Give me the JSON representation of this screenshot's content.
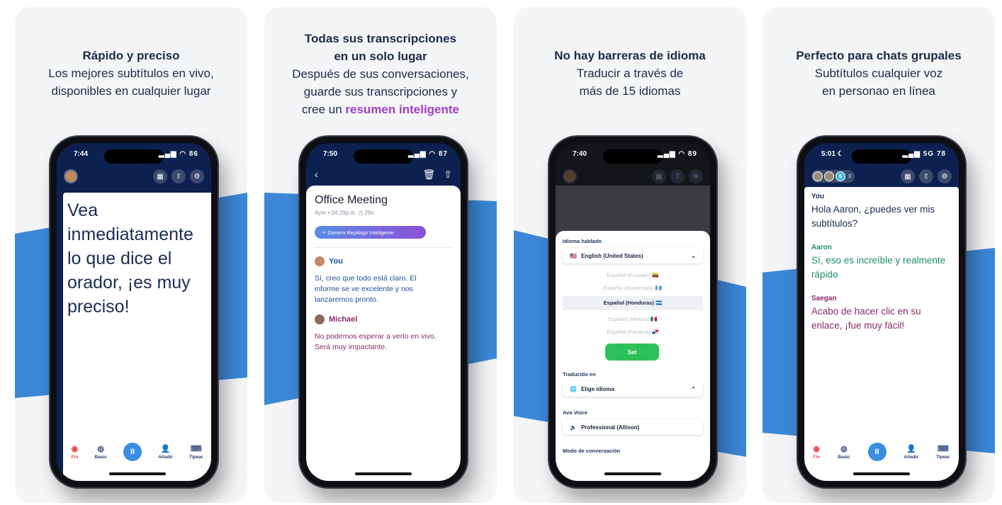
{
  "cards": [
    {
      "caption": {
        "heading": "Rápido y preciso",
        "line1": "Los mejores subtítulos en vivo,",
        "line2": "disponibles en cualquier lugar"
      },
      "status": {
        "time": "7:44",
        "battery": "86"
      },
      "transcript": "Vea inmediatamente lo que dice el orador, ¡es muy preciso!"
    },
    {
      "caption": {
        "heading1": "Todas sus transcripciones",
        "heading2": "en un solo lugar",
        "line1": "Después de sus conversaciones,",
        "line2": "guarde sus transcripciones y",
        "line3_prefix": "cree un ",
        "line3_emphasis": "resumen inteligente"
      },
      "status": {
        "time": "7:50",
        "battery": "87"
      },
      "meeting": {
        "title": "Office Meeting",
        "meta": "Ayer • 04:29p.m.  ◷ 29s",
        "summary_button": "✧ Genera Repilogo Inteligente",
        "speakers": [
          {
            "name": "You",
            "text": "Sí, creo que todo está claro. El informe se ve excelente y nos lanzaremos pronto."
          },
          {
            "name": "Michael",
            "text": "No podemos esperar a verlo en vivo. Será muy impactante."
          }
        ]
      }
    },
    {
      "caption": {
        "heading": "No hay barreras de idioma",
        "line1": "Traducir a través de",
        "line2": "más de 15 idiomas"
      },
      "status": {
        "time": "7:40",
        "battery": "89"
      },
      "language": {
        "spoken_label": "Idioma hablado",
        "spoken_value": "English (United States)",
        "spoken_flag": "🇺🇸",
        "options": [
          {
            "label": "Español (Ecuador) 🇪🇨",
            "active": false
          },
          {
            "label": "Español (Guatemala) 🇬🇹",
            "active": false
          },
          {
            "label": "Español (Honduras) 🇭🇳",
            "active": true
          },
          {
            "label": "Español (Mexico) 🇲🇽",
            "active": false
          },
          {
            "label": "Español (Panama) 🇵🇦",
            "active": false
          }
        ],
        "set_button": "Set",
        "translated_label": "Traducido en",
        "translated_value": "Elige idioma",
        "voice_label": "Ava Voice",
        "voice_value": "Professional (Allison)",
        "mode_label": "Modo de conversación"
      }
    },
    {
      "caption": {
        "heading": "Perfecto para chats grupales",
        "line1": "Subtítulos cualquier voz",
        "line2": "en personao en línea"
      },
      "status": {
        "time": "5:01 ☾",
        "network": "5G",
        "battery": "78"
      },
      "participants_count": "3",
      "participant_initial": "S",
      "chat": [
        {
          "who": "You",
          "msg": "Hola Aaron, ¿puedes ver mis subtítulos?"
        },
        {
          "who": "Aaron",
          "msg": "Sí, eso es increíble y realmente rápido"
        },
        {
          "who": "Saegan",
          "msg": "Acabo de hacer clic en su enlace, ¡fue muy fácil!"
        }
      ]
    }
  ],
  "bottom_bar": {
    "fin": "Fin",
    "basic": "Basic",
    "add": "Añadir",
    "type": "Tipear"
  },
  "icons": {
    "record": "◉",
    "basic": "◍",
    "pause": "II",
    "add_user": "👤",
    "keyboard": "⌨",
    "qr": "▦",
    "share": "⇧",
    "gear": "⚙",
    "back": "‹",
    "trash": "🗑",
    "chevron_down": "⌄",
    "chevron_up": "⌃",
    "speaker": "🔈",
    "globe": "🌐"
  },
  "colors": {
    "band_blue": "#3b87d6",
    "navy": "#0d2150",
    "purple_emphasis": "#9c3fc9",
    "set_green": "#2fc05a",
    "aaron_green": "#1d8f6a",
    "michael_plum": "#8a2c6b"
  }
}
